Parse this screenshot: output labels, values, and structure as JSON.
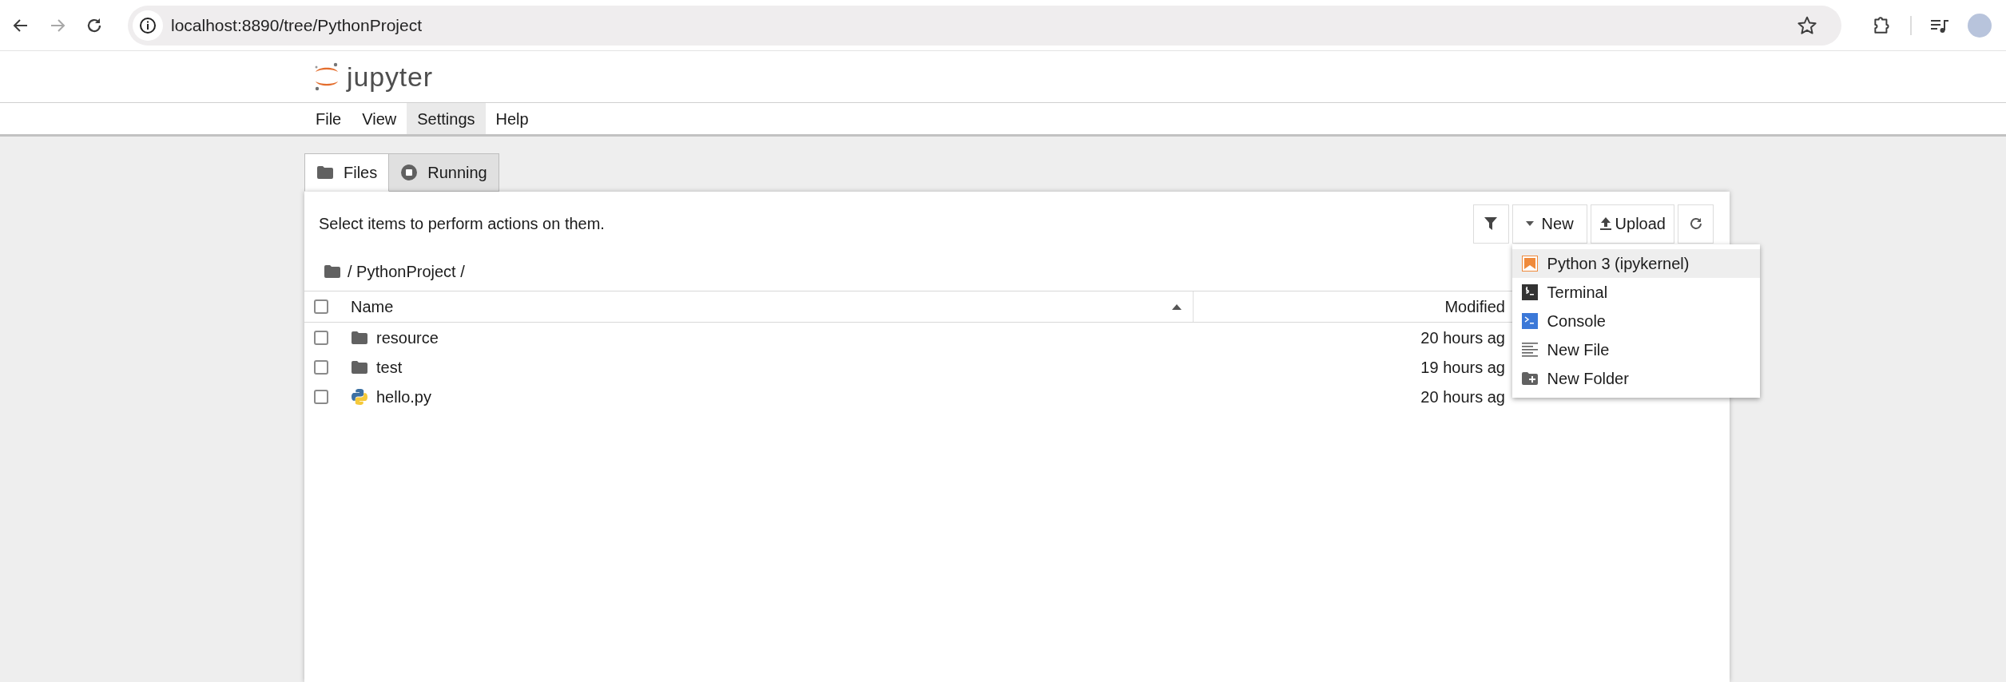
{
  "browser": {
    "url": "localhost:8890/tree/PythonProject",
    "forward_disabled": true
  },
  "app": {
    "logo_text": "jupyter"
  },
  "menu": [
    {
      "label": "File",
      "highlighted": false
    },
    {
      "label": "View",
      "highlighted": false
    },
    {
      "label": "Settings",
      "highlighted": true
    },
    {
      "label": "Help",
      "highlighted": false
    }
  ],
  "tabs": [
    {
      "label": "Files",
      "selected": true,
      "kind": "folder"
    },
    {
      "label": "Running",
      "selected": false,
      "kind": "running"
    }
  ],
  "hint": "Select items to perform actions on them.",
  "toolbar": {
    "new": "New",
    "upload": "Upload"
  },
  "breadcrumb": "/ PythonProject /",
  "table": {
    "columns": [
      "Name",
      "Modified"
    ],
    "all_checked": false,
    "rows": [
      {
        "name": "resource",
        "kind": "folder",
        "modified": "20 hours ag",
        "checked": false
      },
      {
        "name": "test",
        "kind": "folder",
        "modified": "19 hours ag",
        "checked": false
      },
      {
        "name": "hello.py",
        "kind": "python",
        "modified": "20 hours ag",
        "checked": false
      }
    ]
  },
  "new_menu": [
    {
      "label": "Python 3 (ipykernel)",
      "kind": "notebook",
      "highlighted": true
    },
    {
      "label": "Terminal",
      "kind": "terminal",
      "highlighted": false
    },
    {
      "label": "Console",
      "kind": "console",
      "highlighted": false
    },
    {
      "label": "New File",
      "kind": "file",
      "highlighted": false
    },
    {
      "label": "New Folder",
      "kind": "folder",
      "highlighted": false
    }
  ]
}
